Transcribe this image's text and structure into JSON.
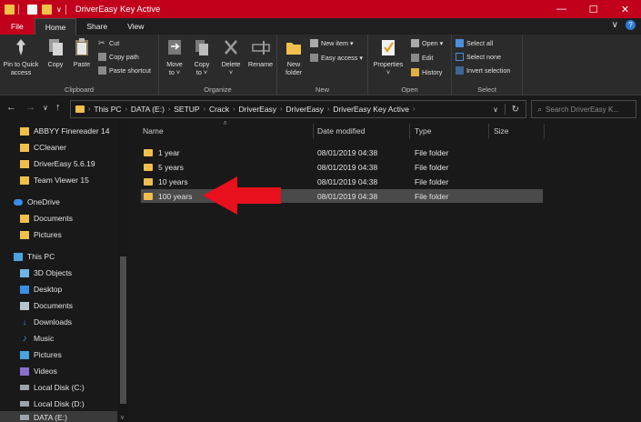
{
  "window": {
    "title": "DriverEasy Key Active",
    "controls": [
      "minimize",
      "maximize",
      "close"
    ]
  },
  "ribbon_tabs": [
    "File",
    "Home",
    "Share",
    "View"
  ],
  "ribbon": {
    "clipboard": {
      "label": "Clipboard",
      "pin": "Pin to Quick access",
      "pin_line1": "Pin to Quick",
      "pin_line2": "access",
      "copy": "Copy",
      "paste": "Paste",
      "cut": "Cut",
      "copy_path": "Copy path",
      "paste_shortcut": "Paste shortcut"
    },
    "organize": {
      "label": "Organize",
      "move_to_line1": "Move",
      "move_to_line2": "to ˅",
      "copy_to_line1": "Copy",
      "copy_to_line2": "to ˅",
      "delete": "Delete",
      "delete_arrow": "˅",
      "rename": "Rename"
    },
    "new": {
      "label": "New",
      "new_folder_line1": "New",
      "new_folder_line2": "folder",
      "new_item": "New item ▾",
      "easy_access": "Easy access ▾"
    },
    "open": {
      "label": "Open",
      "properties": "Properties",
      "properties_arrow": "˅",
      "open": "Open ▾",
      "edit": "Edit",
      "history": "History"
    },
    "select": {
      "label": "Select",
      "select_all": "Select all",
      "select_none": "Select none",
      "invert_selection": "Invert selection"
    }
  },
  "address": {
    "breadcrumbs": [
      "This PC",
      "DATA (E:)",
      "SETUP",
      "Crack",
      "DriverEasy",
      "DriverEasy",
      "DriverEasy Key Active"
    ],
    "search_placeholder": "Search DriverEasy K..."
  },
  "sidebar": {
    "items": [
      {
        "label": "ABBYY Finereader 14",
        "icon": "folder-icon"
      },
      {
        "label": "CCleaner",
        "icon": "folder-icon"
      },
      {
        "label": "DriverEasy 5.6.19",
        "icon": "folder-icon"
      },
      {
        "label": "Team Viewer 15",
        "icon": "folder-icon"
      },
      {
        "label": "OneDrive",
        "icon": "cloud-icon"
      },
      {
        "label": "Documents",
        "icon": "folder-icon"
      },
      {
        "label": "Pictures",
        "icon": "folder-icon"
      },
      {
        "label": "This PC",
        "icon": "computer-icon"
      },
      {
        "label": "3D Objects",
        "icon": "cube-icon"
      },
      {
        "label": "Desktop",
        "icon": "desktop-icon"
      },
      {
        "label": "Documents",
        "icon": "document-icon"
      },
      {
        "label": "Downloads",
        "icon": "download-icon"
      },
      {
        "label": "Music",
        "icon": "music-icon"
      },
      {
        "label": "Pictures",
        "icon": "picture-icon"
      },
      {
        "label": "Videos",
        "icon": "video-icon"
      },
      {
        "label": "Local Disk (C:)",
        "icon": "drive-icon"
      },
      {
        "label": "Local Disk (D:)",
        "icon": "drive-icon"
      },
      {
        "label": "DATA (E:)",
        "icon": "drive-icon"
      }
    ]
  },
  "file_list": {
    "columns": [
      "Name",
      "Date modified",
      "Type",
      "Size"
    ],
    "rows": [
      {
        "name": "1 year",
        "date": "08/01/2019 04:38",
        "type": "File folder",
        "size": ""
      },
      {
        "name": "5 years",
        "date": "08/01/2019 04:38",
        "type": "File folder",
        "size": ""
      },
      {
        "name": "10 years",
        "date": "08/01/2019 04:38",
        "type": "File folder",
        "size": ""
      },
      {
        "name": "100 years",
        "date": "08/01/2019 04:38",
        "type": "File folder",
        "size": ""
      }
    ],
    "selected_row": 3
  },
  "colors": {
    "titlebar": "#c1001c",
    "ribbon": "#2b2b2b",
    "background": "#191919",
    "folder": "#f0bf4c",
    "annotation_arrow": "#e8101c"
  }
}
